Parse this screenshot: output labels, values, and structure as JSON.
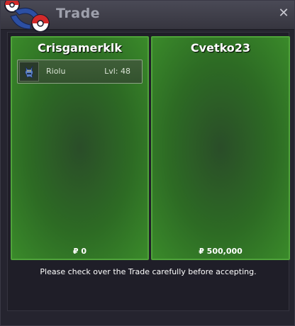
{
  "window": {
    "title": "Trade"
  },
  "left_panel": {
    "player_name": "Crisgamerklk",
    "pokemon": [
      {
        "name": "Riolu",
        "level": "Lvl: 48",
        "icon": "riolu-sprite-icon"
      }
    ],
    "money": "₽ 0"
  },
  "right_panel": {
    "player_name": "Cvetko23",
    "pokemon": [],
    "money": "₽ 500,000"
  },
  "notice": "Please check over the Trade carefully before accepting.",
  "colors": {
    "panel_green": "#2d6b24",
    "panel_border": "#4fa33a",
    "window_bg": "#25242f"
  }
}
